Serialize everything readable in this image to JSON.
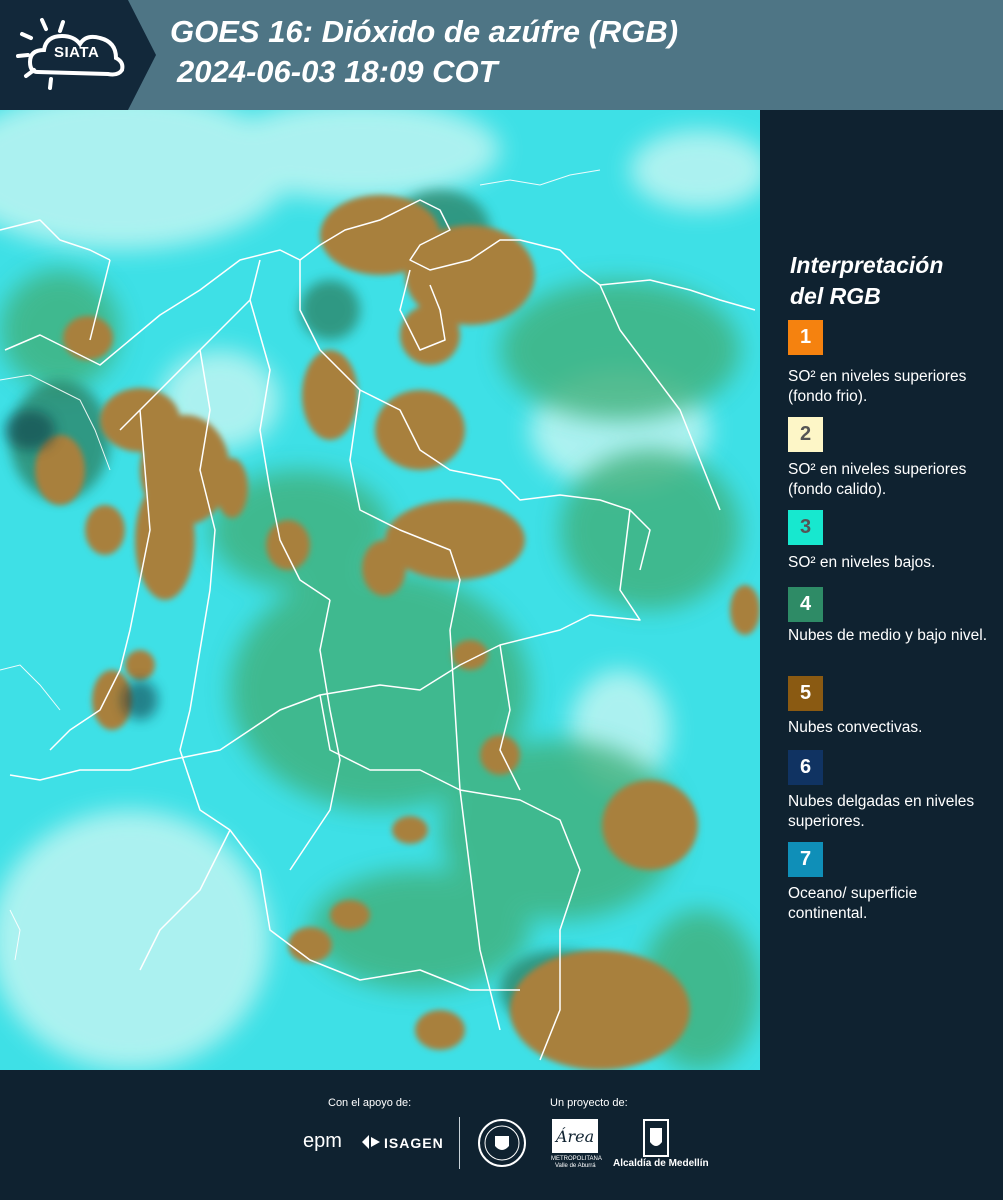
{
  "header": {
    "logo_text": "SIATA",
    "title_line1": "GOES 16: Dióxido de azúfre (RGB)",
    "title_line2": "2024-06-03 18:09 COT"
  },
  "map": {
    "colors": {
      "background_cyan": "#3ee0e6",
      "light_cloud": "#b6f4f2",
      "green": "#3fb07a",
      "dark_green": "#2b7a5a",
      "convective_brown": "#a8803e",
      "border_white": "#ffffff"
    }
  },
  "legend": {
    "title_line1": "Interpretación",
    "title_line2": "del RGB",
    "items": [
      {
        "number": "1",
        "color": "#f5820f",
        "text_color": "#ffffff",
        "label": "SO² en niveles superiores (fondo frio)."
      },
      {
        "number": "2",
        "color": "#fdf6c7",
        "text_color": "#555555",
        "label": "SO² en niveles superiores (fondo calido)."
      },
      {
        "number": "3",
        "color": "#17e8cf",
        "text_color": "#555555",
        "label": "SO² en niveles bajos."
      },
      {
        "number": "4",
        "color": "#2e8b66",
        "text_color": "#ffffff",
        "label": "Nubes de medio y bajo nivel."
      },
      {
        "number": "5",
        "color": "#8a5a12",
        "text_color": "#ffffff",
        "label": "Nubes convectivas."
      },
      {
        "number": "6",
        "color": "#103362",
        "text_color": "#ffffff",
        "label": "Nubes delgadas en niveles superiores."
      },
      {
        "number": "7",
        "color": "#0f8fb8",
        "text_color": "#ffffff",
        "label": "Oceano/ superficie continental."
      }
    ]
  },
  "footer": {
    "support_label": "Con el apoyo de:",
    "project_label": "Un proyecto de:",
    "sponsor_epm": "epm",
    "sponsor_isagen": "ISAGEN",
    "partner_area_line1": "Área",
    "partner_area_line2": "METROPOLITANA",
    "partner_area_line3": "Valle de Aburrá",
    "partner_alcaldia": "Alcaldía de Medellín"
  }
}
